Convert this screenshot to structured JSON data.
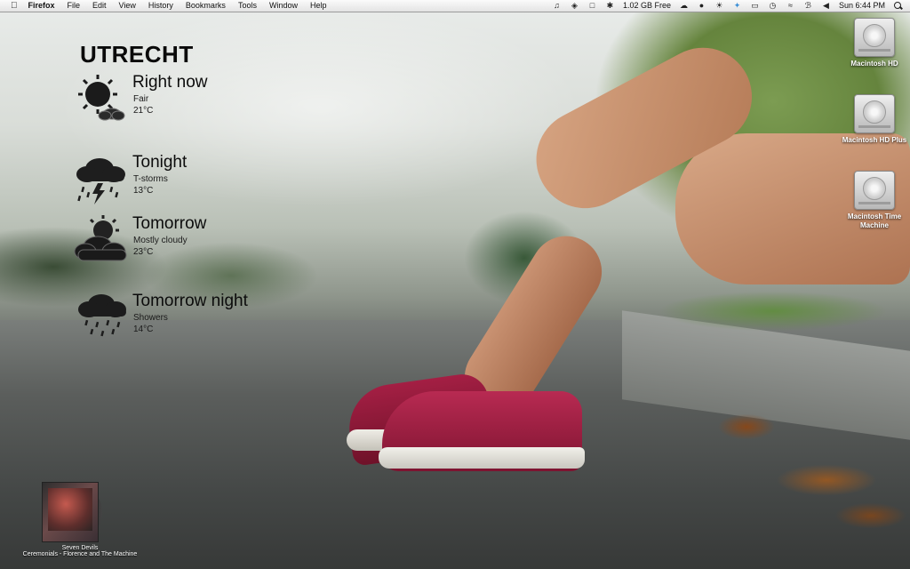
{
  "menubar": {
    "app_name": "Firefox",
    "menus": [
      "File",
      "Edit",
      "View",
      "History",
      "Bookmarks",
      "Tools",
      "Window",
      "Help"
    ],
    "status": {
      "disk_free": "1.02 GB Free",
      "clock": "Sun 6:44 PM"
    },
    "icons": [
      "apple-icon",
      "music-note-icon",
      "dropbox-icon",
      "screen-capture-icon",
      "paw-icon",
      "cloud-icon",
      "growl-icon",
      "cloudapp-icon",
      "twitter-icon",
      "display-icon",
      "time-machine-icon",
      "wifi-icon",
      "bluetooth-icon",
      "volume-icon",
      "spotlight-icon"
    ]
  },
  "weather": {
    "city": "UTRECHT",
    "forecasts": [
      {
        "label": "Right now",
        "condition": "Fair",
        "temp": "21°C",
        "icon": "sun-cloud-icon"
      },
      {
        "label": "Tonight",
        "condition": "T-storms",
        "temp": "13°C",
        "icon": "thunderstorm-icon"
      },
      {
        "label": "Tomorrow",
        "condition": "Mostly cloudy",
        "temp": "23°C",
        "icon": "mostly-cloudy-icon"
      },
      {
        "label": "Tomorrow night",
        "condition": "Showers",
        "temp": "14°C",
        "icon": "showers-icon"
      }
    ]
  },
  "desktop": {
    "drives": [
      {
        "name": "Macintosh HD"
      },
      {
        "name": "Macintosh HD Plus"
      },
      {
        "name": "Macintosh Time Machine"
      }
    ]
  },
  "now_playing": {
    "track": "Seven Devils",
    "album_artist": "Ceremonials - Florence and The Machine",
    "icon": "album-art-icon"
  }
}
